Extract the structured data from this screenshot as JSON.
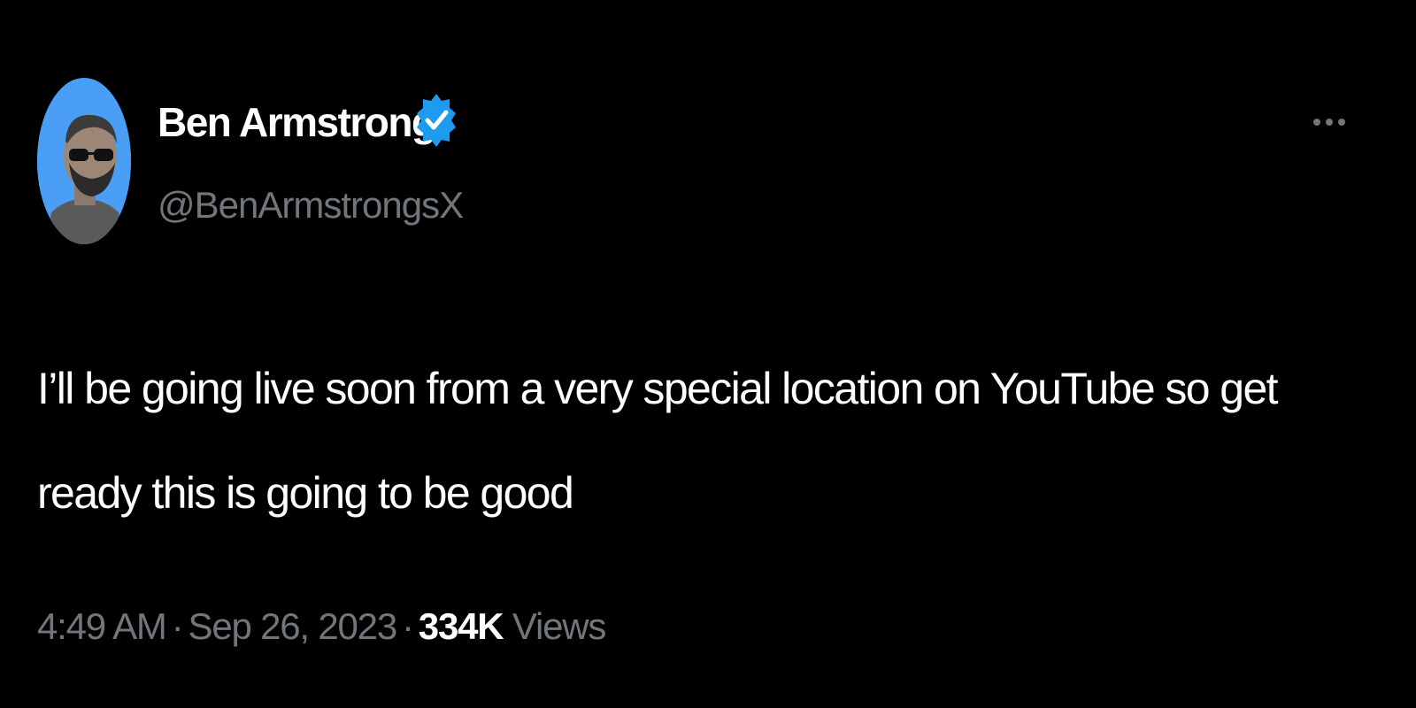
{
  "author": {
    "name": "Ben Armstrong",
    "handle": "@BenArmstrongsX",
    "avatar_icon": "avatar-photo",
    "verified_icon": "verified-badge-icon"
  },
  "more_icon": "more-options-icon",
  "tweet": {
    "text": "I’ll be going live soon from a very special location on YouTube so get ready this is going to be good"
  },
  "meta": {
    "time": "4:49 AM",
    "separator": "·",
    "date": "Sep 26, 2023",
    "views_count": "334K",
    "views_label": "Views"
  },
  "colors": {
    "background": "#000000",
    "text_primary": "#ffffff",
    "text_secondary": "#71767b",
    "verified_blue": "#1d9bf0",
    "avatar_bg": "#4a9ef5"
  }
}
